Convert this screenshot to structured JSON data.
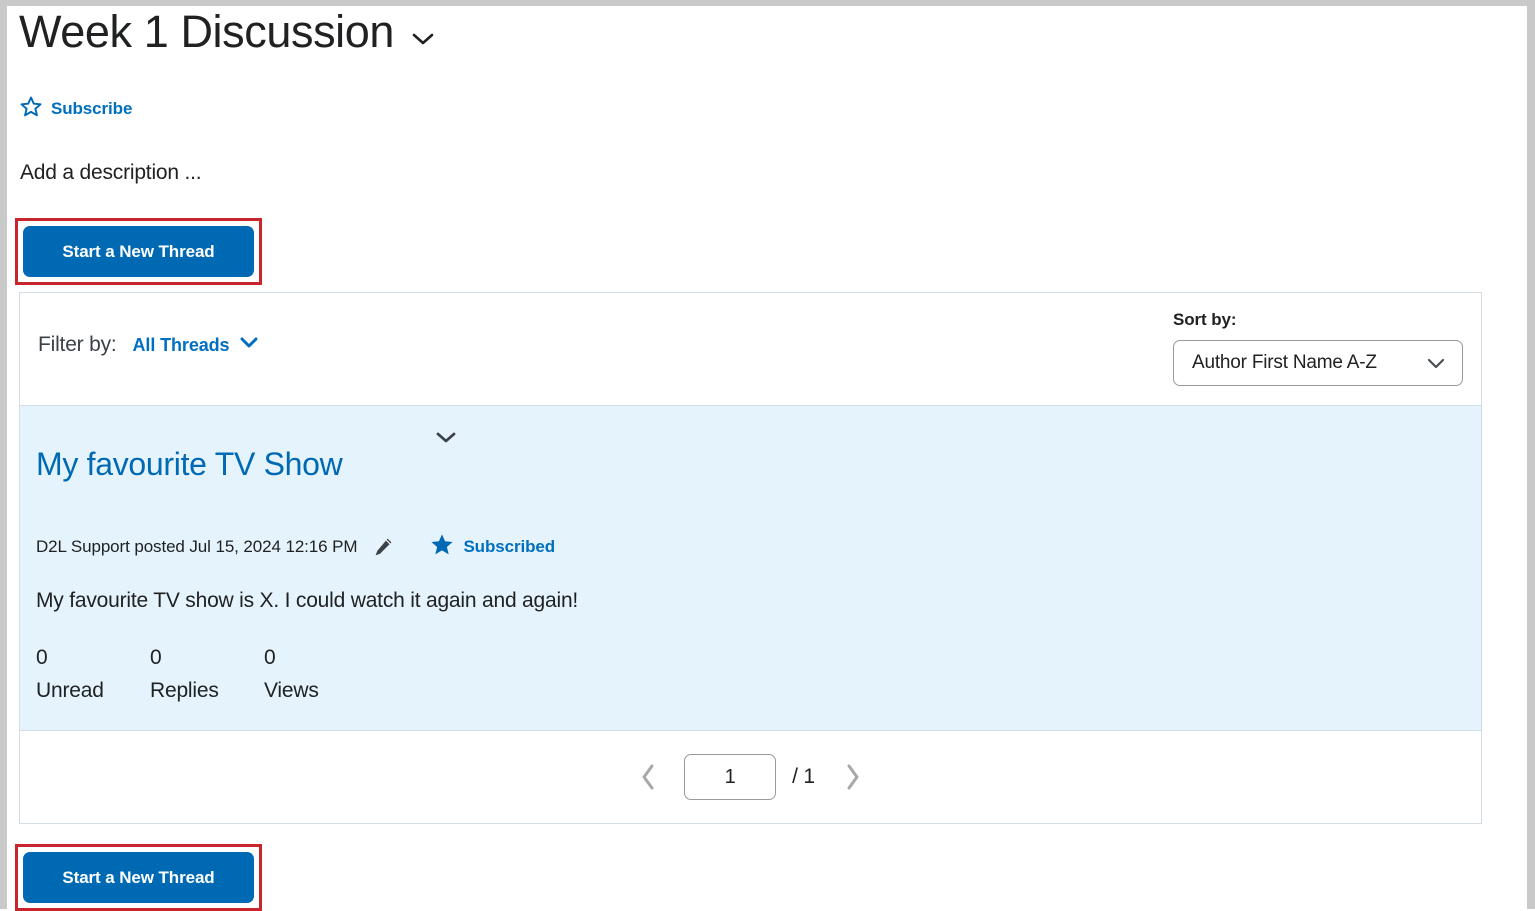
{
  "header": {
    "title": "Week 1 Discussion",
    "title_chevron_icon": "chevron-down-icon",
    "subscribe": {
      "icon": "star-outline-icon",
      "label": "Subscribe"
    },
    "description": "Add a description ..."
  },
  "actions": {
    "start_new_thread_label": "Start a New Thread",
    "highlight_color": "#c9252d",
    "button_color": "#0069b4"
  },
  "filter_bar": {
    "filter_by_label": "Filter by:",
    "filter_value": "All Threads",
    "filter_chevron_icon": "chevron-down-icon",
    "sort_by_label": "Sort by:",
    "sort_value": "Author First Name A-Z",
    "sort_chevron_icon": "chevron-down-icon",
    "sort_options": [
      "Author First Name A-Z"
    ]
  },
  "thread": {
    "chevron_icon": "chevron-down-icon",
    "title": "My favourite TV Show",
    "meta_text": "D2L Support posted Jul 15, 2024 12:16 PM",
    "edit_icon": "pencil-icon",
    "subscribed": {
      "icon": "star-filled-icon",
      "label": "Subscribed"
    },
    "body": "My favourite TV show is X. I could watch it again and again!",
    "stats": [
      {
        "value": "0",
        "label": "Unread"
      },
      {
        "value": "0",
        "label": "Replies"
      },
      {
        "value": "0",
        "label": "Views"
      }
    ],
    "background_color": "#e5f4fc"
  },
  "pagination": {
    "prev_icon": "chevron-left-icon",
    "next_icon": "chevron-right-icon",
    "current_page": "1",
    "total_label": "/ 1"
  }
}
